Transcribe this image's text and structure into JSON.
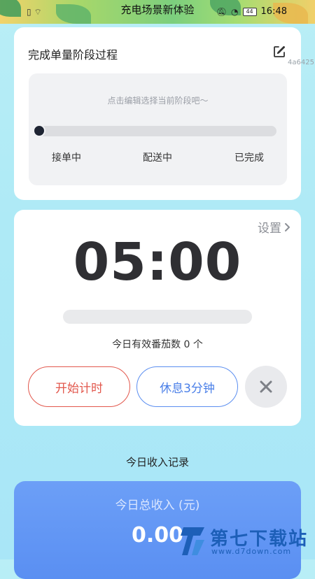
{
  "status_bar": {
    "title": "充电场景新体验",
    "time": "16:48",
    "battery": "44"
  },
  "stage_card": {
    "title": "完成单量阶段过程",
    "hint": "点击编辑选择当前阶段吧～",
    "stages": [
      "接单中",
      "配送中",
      "已完成"
    ],
    "watermark_code": "4a6425"
  },
  "timer_card": {
    "settings_label": "设置",
    "timer_value": "05:00",
    "progress": 0,
    "count_text": "今日有效番茄数 0 个",
    "start_label": "开始计时",
    "rest_label": "休息3分钟"
  },
  "income": {
    "section_title": "今日收入记录",
    "total_label": "今日总收入 (元)",
    "total_value": "0.00"
  },
  "site_watermark": {
    "brand": "第七下载站",
    "url": "www.d7down.com"
  },
  "colors": {
    "accent_blue": "#5b8ef0",
    "accent_red": "#e2574c",
    "background": "#b9eef6"
  }
}
